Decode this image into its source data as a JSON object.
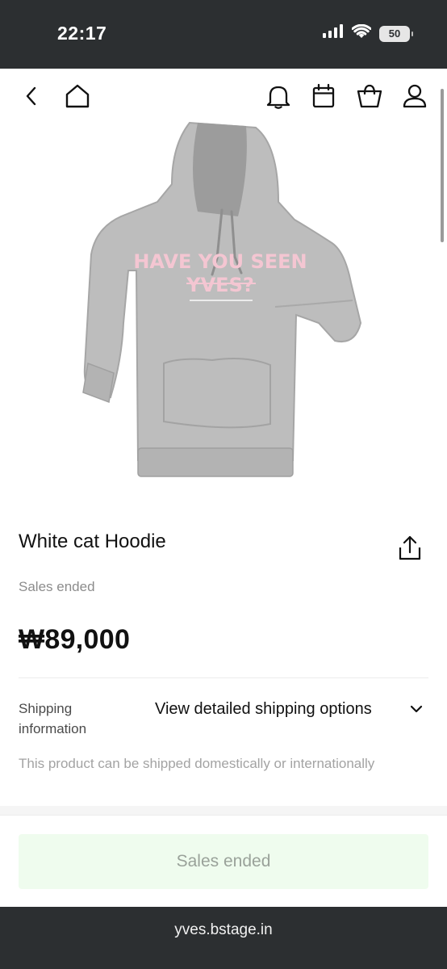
{
  "status_bar": {
    "time": "22:17",
    "battery": "50",
    "icons": [
      "signal-icon",
      "wifi-icon",
      "battery-icon"
    ]
  },
  "nav": {
    "left_icons": [
      "back-icon",
      "home-icon"
    ],
    "right_icons": [
      "bell-icon",
      "calendar-icon",
      "shopping-bag-icon",
      "user-icon"
    ]
  },
  "product": {
    "image_icon": "hoodie-image",
    "image_text_line1": "HAVE YOU SEEN",
    "image_text_line2": "YVES?",
    "title": "White cat Hoodie",
    "status": "Sales ended",
    "price": "₩89,000"
  },
  "shipping": {
    "label": "Shipping information",
    "dropdown_value": "View detailed shipping options",
    "note": "This product can be shipped domestically or internationally"
  },
  "cta": {
    "label": "Sales ended"
  },
  "browser": {
    "url": "yves.bstage.in"
  },
  "colors": {
    "status_bar_bg": "#2c2f31",
    "hoodie_gray": "#b9b9b9",
    "print_pink": "#f4c6d2",
    "cta_bg": "#effcee",
    "cta_text": "#9aa29a",
    "muted_text": "#8c8c8c"
  }
}
